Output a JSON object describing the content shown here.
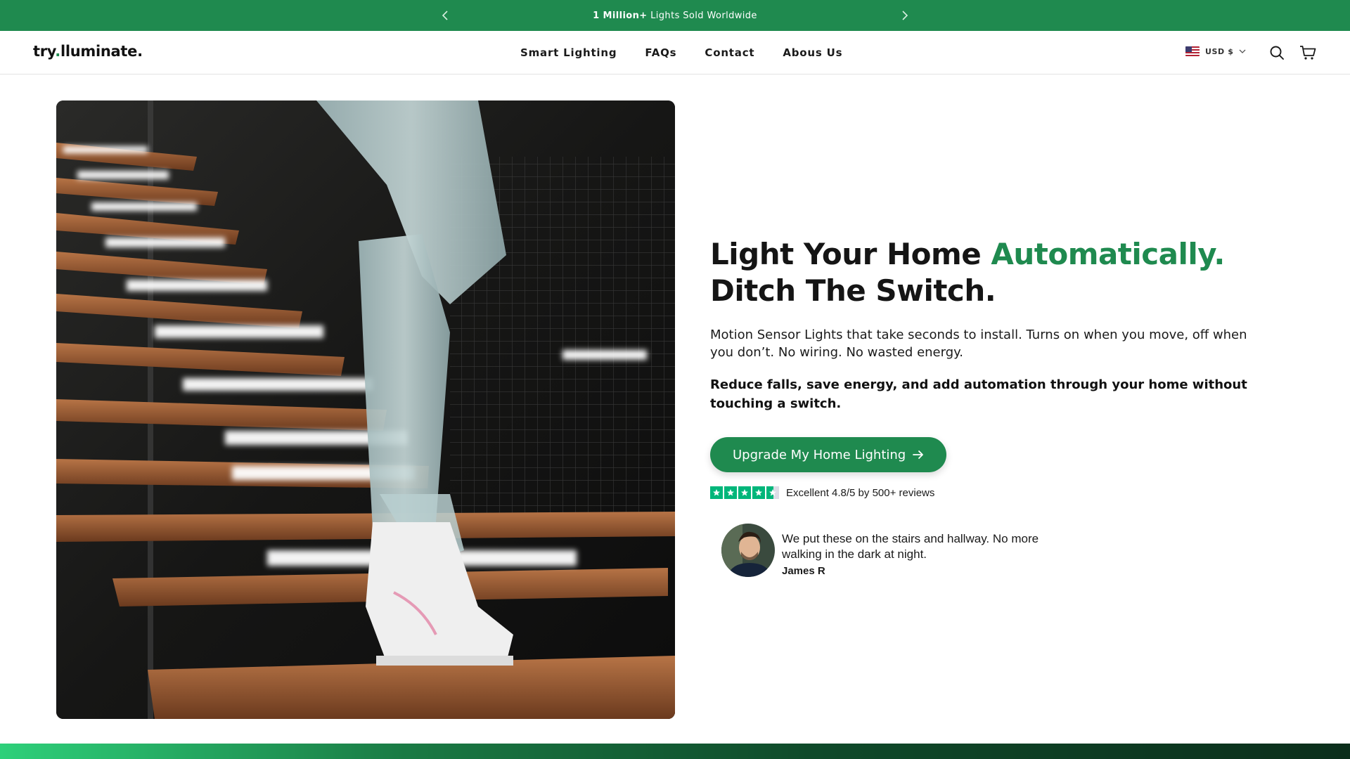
{
  "announcement": {
    "highlight": "1 Million+",
    "text": " Lights Sold Worldwide"
  },
  "header": {
    "logo": {
      "prefix": "try",
      "dot": ".",
      "suffix": "lluminate."
    },
    "nav": [
      "Smart Lighting",
      "FAQs",
      "Contact",
      "Abous Us"
    ],
    "currency": "USD $"
  },
  "hero": {
    "headline_part1": "Light Your Home ",
    "headline_accent": "Automatically.",
    "headline_line2": "Ditch The Switch.",
    "description": "Motion Sensor Lights that take seconds to install. Turns on when you move, off when you don’t. No wiring. No wasted energy.",
    "description_bold": "Reduce falls, save energy, and add automation through your home without touching a switch.",
    "cta_label": "Upgrade My Home Lighting",
    "rating_text": "Excellent 4.8/5 by 500+ reviews",
    "rating_value": 4.8,
    "testimonial": {
      "quote": "We put these on the stairs and hallway. No more walking in the dark at night.",
      "author": "James R"
    }
  },
  "colors": {
    "brand_green": "#1f8a4f",
    "star_green": "#00b67a"
  },
  "icons": [
    "chevron-left-icon",
    "chevron-right-icon",
    "us-flag-icon",
    "chevron-down-icon",
    "search-icon",
    "cart-icon",
    "arrow-right-icon",
    "star-icon"
  ]
}
